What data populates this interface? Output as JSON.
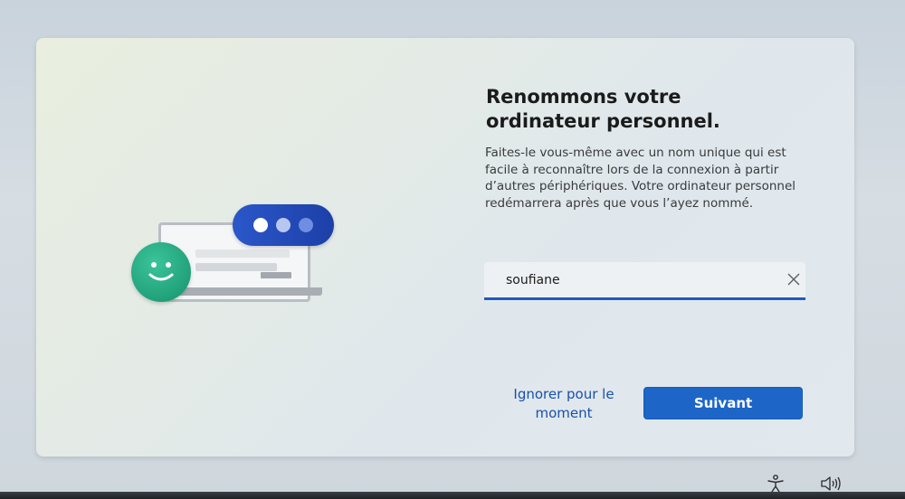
{
  "setup": {
    "title": "Renommons votre ordinateur personnel.",
    "description": "Faites-le vous-même avec un nom unique qui est facile à reconnaître lors de la connexion à partir d’autres périphériques. Votre ordinateur personnel redémarrera après que vous l’ayez nommé.",
    "pc_name_value": "soufiane",
    "skip_label": "Ignorer pour le moment",
    "next_label": "Suivant"
  },
  "illustration": {
    "icons": [
      "laptop-icon",
      "chat-bubble-icon",
      "smiley-icon"
    ]
  },
  "taskbar": {
    "icons": [
      "accessibility-icon",
      "volume-icon"
    ]
  },
  "colors": {
    "accent": "#1d66c7",
    "link": "#1b4fae",
    "chat_bubble": "#2b57c9",
    "smiley": "#1fa67d"
  }
}
